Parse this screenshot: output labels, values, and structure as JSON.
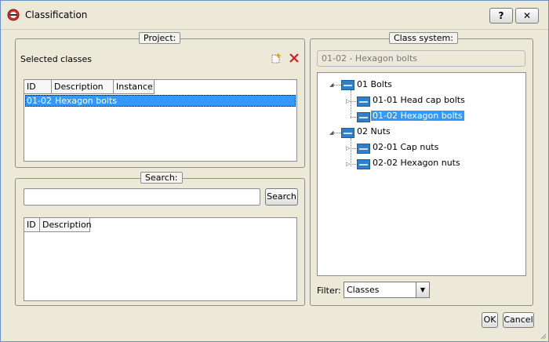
{
  "window": {
    "title": "Classification",
    "help_label": "?",
    "close_label": "✕"
  },
  "project": {
    "group_title": "Project:",
    "selected_label": "Selected classes",
    "columns": [
      "ID",
      "Description",
      "Instance"
    ],
    "rows": [
      {
        "id": "01-02",
        "description": "Hexagon bolts",
        "instance": ""
      }
    ]
  },
  "search": {
    "group_title": "Search:",
    "input_value": "",
    "button_label": "Search",
    "columns": [
      "ID",
      "Description"
    ]
  },
  "class_system": {
    "group_title": "Class system:",
    "selected_path": "01-02 - Hexagon bolts",
    "tree": {
      "n1": "01 Bolts",
      "n1_1": "01-01 Head cap bolts",
      "n1_2": "01-02 Hexagon bolts",
      "n2": "02 Nuts",
      "n2_1": "02-01 Cap nuts",
      "n2_2": "02-02 Hexagon nuts"
    },
    "filter_label": "Filter:",
    "filter_value": "Classes"
  },
  "footer": {
    "ok_label": "OK",
    "cancel_label": "Cancel"
  },
  "colors": {
    "selection": "#3399ff",
    "border": "#8e8e8e",
    "dialog_bg": "#ece9d8",
    "delete_icon": "#cc2222"
  }
}
